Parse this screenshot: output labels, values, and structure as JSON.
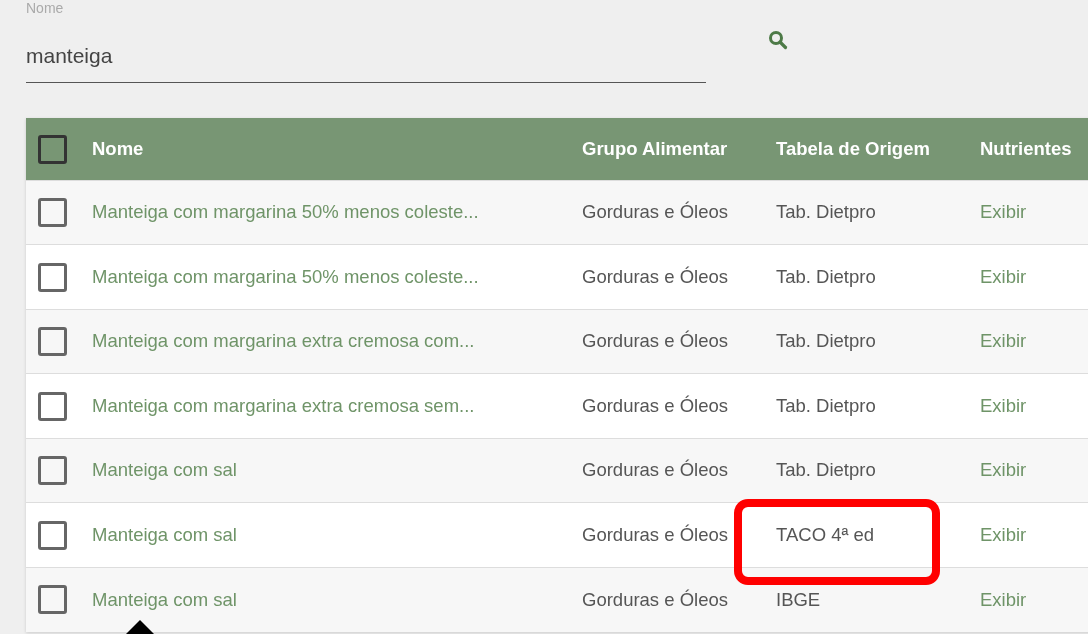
{
  "search": {
    "label": "Nome",
    "value": "manteiga"
  },
  "table": {
    "select_all": {
      "checked": false
    },
    "columns": [
      "Nome",
      "Grupo Alimentar",
      "Tabela de Origem",
      "Nutrientes"
    ],
    "rows": [
      {
        "checked": false,
        "name": "Manteiga com margarina 50% menos coleste...",
        "group": "Gorduras e Óleos",
        "source": "Tab. Dietpro",
        "action": "Exibir"
      },
      {
        "checked": false,
        "name": "Manteiga com margarina 50% menos coleste...",
        "group": "Gorduras e Óleos",
        "source": "Tab. Dietpro",
        "action": "Exibir"
      },
      {
        "checked": false,
        "name": "Manteiga com margarina extra cremosa com...",
        "group": "Gorduras e Óleos",
        "source": "Tab. Dietpro",
        "action": "Exibir"
      },
      {
        "checked": false,
        "name": "Manteiga com margarina extra cremosa sem...",
        "group": "Gorduras e Óleos",
        "source": "Tab. Dietpro",
        "action": "Exibir"
      },
      {
        "checked": false,
        "name": "Manteiga com sal",
        "group": "Gorduras e Óleos",
        "source": "Tab. Dietpro",
        "action": "Exibir"
      },
      {
        "checked": false,
        "name": "Manteiga com sal",
        "group": "Gorduras e Óleos",
        "source": "TACO 4ª ed",
        "action": "Exibir",
        "highlighted": true
      },
      {
        "checked": false,
        "name": "Manteiga com sal",
        "group": "Gorduras e Óleos",
        "source": "IBGE",
        "action": "Exibir",
        "pointed": true
      }
    ]
  }
}
